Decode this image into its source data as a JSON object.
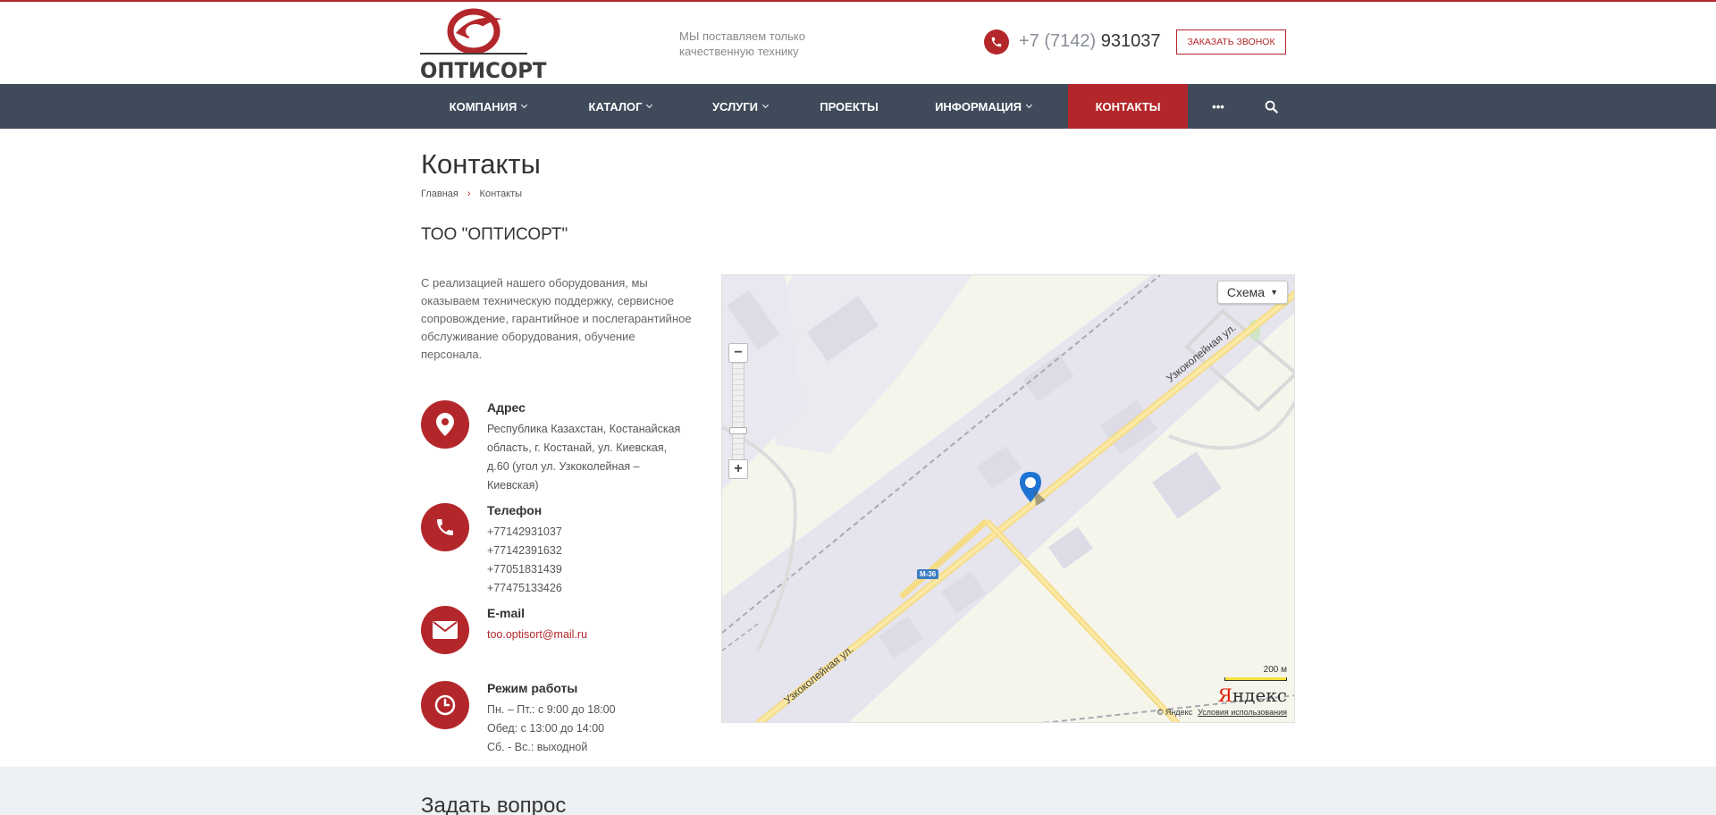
{
  "header": {
    "logo_text": "ОПТИСОРТ",
    "slogan_line1": "МЫ поставляем только",
    "slogan_line2": "качественную технику",
    "phone_code": "+7 (7142)",
    "phone_main": "931037",
    "callback_label": "Заказать звонок"
  },
  "nav": {
    "items": [
      {
        "label": "Компания"
      },
      {
        "label": "Каталог"
      },
      {
        "label": "Услуги"
      },
      {
        "label": "Проекты"
      },
      {
        "label": "Информация"
      },
      {
        "label": "Контакты"
      }
    ],
    "more_label": "•••"
  },
  "page": {
    "title": "Контакты",
    "breadcrumb": {
      "home": "Главная",
      "sep": "›",
      "current": "Контакты"
    },
    "company": "ТОО \"ОПТИСОРТ\"",
    "intro": "С реализацией нашего оборудования, мы оказываем техническую поддержку, сервисное сопровождение, гарантийное и послегарантийное обслуживание оборудования, обучение персонала."
  },
  "contacts": {
    "address": {
      "title": "Адрес",
      "lines": [
        "Республика Казахстан, Костанайская",
        "область, г. Костанай, ул. Киевская,",
        "д.60 (угол ул. Узкоколейная –",
        "Киевская)"
      ]
    },
    "phone": {
      "title": "Телефон",
      "lines": [
        "+77142931037",
        "+77142391632",
        "+77051831439",
        "+77475133426"
      ]
    },
    "email": {
      "title": "E-mail",
      "value": "too.optisort@mail.ru"
    },
    "hours": {
      "title": "Режим работы",
      "lines": [
        "Пн. – Пт.: с 9:00 до 18:00",
        "Обед: с 13:00 до 14:00",
        "Сб. - Вс.: выходной"
      ]
    }
  },
  "map": {
    "scheme_label": "Схема",
    "zoom_in": "+",
    "zoom_out": "−",
    "road_label_1": "Узкоколейная ул.",
    "road_label_2": "Узкоколейная ул.",
    "route_badge": "М-36",
    "scale_label": "200 м",
    "yandex_logo_y": "Я",
    "yandex_logo_rest": "ндекс",
    "copyright": "© Яндекс",
    "terms_link": "Условия использования"
  },
  "bottom": {
    "ask_title": "Задать вопрос"
  },
  "colors": {
    "accent": "#b3272b",
    "nav_bg": "#3f4a5a",
    "map_bg": "#f6f5ec"
  }
}
